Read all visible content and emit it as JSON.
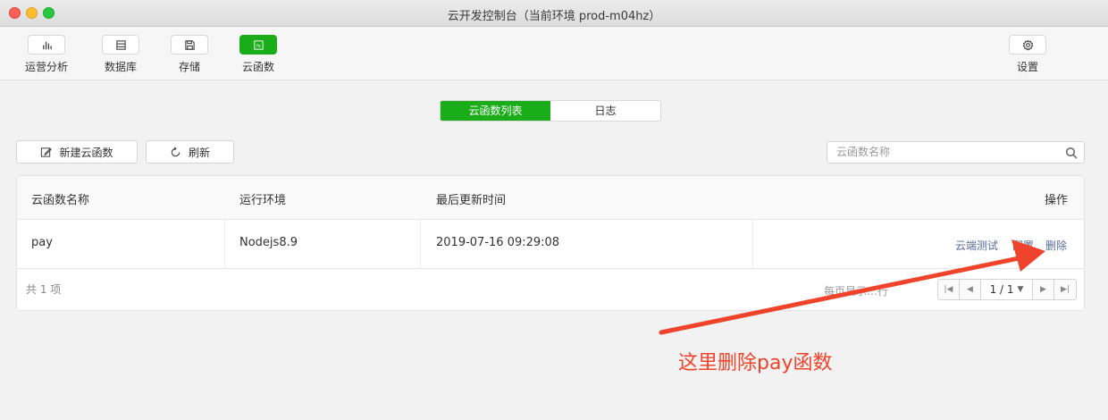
{
  "window": {
    "title": "云开发控制台（当前环境 prod-m04hz）"
  },
  "toolbar": {
    "items": [
      {
        "label": "运营分析",
        "icon": "bar-chart-icon"
      },
      {
        "label": "数据库",
        "icon": "database-icon"
      },
      {
        "label": "存储",
        "icon": "save-icon"
      },
      {
        "label": "云函数",
        "icon": "function-icon",
        "active": true
      }
    ],
    "settings_label": "设置"
  },
  "tabs": [
    {
      "label": "云函数列表",
      "active": true
    },
    {
      "label": "日志",
      "active": false
    }
  ],
  "actions": {
    "new_label": "新建云函数",
    "refresh_label": "刷新"
  },
  "search": {
    "placeholder": "云函数名称"
  },
  "table": {
    "columns": [
      "云函数名称",
      "运行环境",
      "最后更新时间",
      "操作"
    ],
    "rows": [
      {
        "name": "pay",
        "runtime": "Nodejs8.9",
        "updated": "2019-07-16 09:29:08",
        "ops": [
          "云端测试",
          "配置",
          "删除"
        ]
      }
    ]
  },
  "footer": {
    "total": "共 1 项",
    "per_page": "每页显示…行",
    "page": "1 / 1"
  },
  "annotation": {
    "text": "这里删除pay函数",
    "color": "#f0432b"
  },
  "colors": {
    "accent": "#1aad19",
    "link": "#576b95"
  }
}
